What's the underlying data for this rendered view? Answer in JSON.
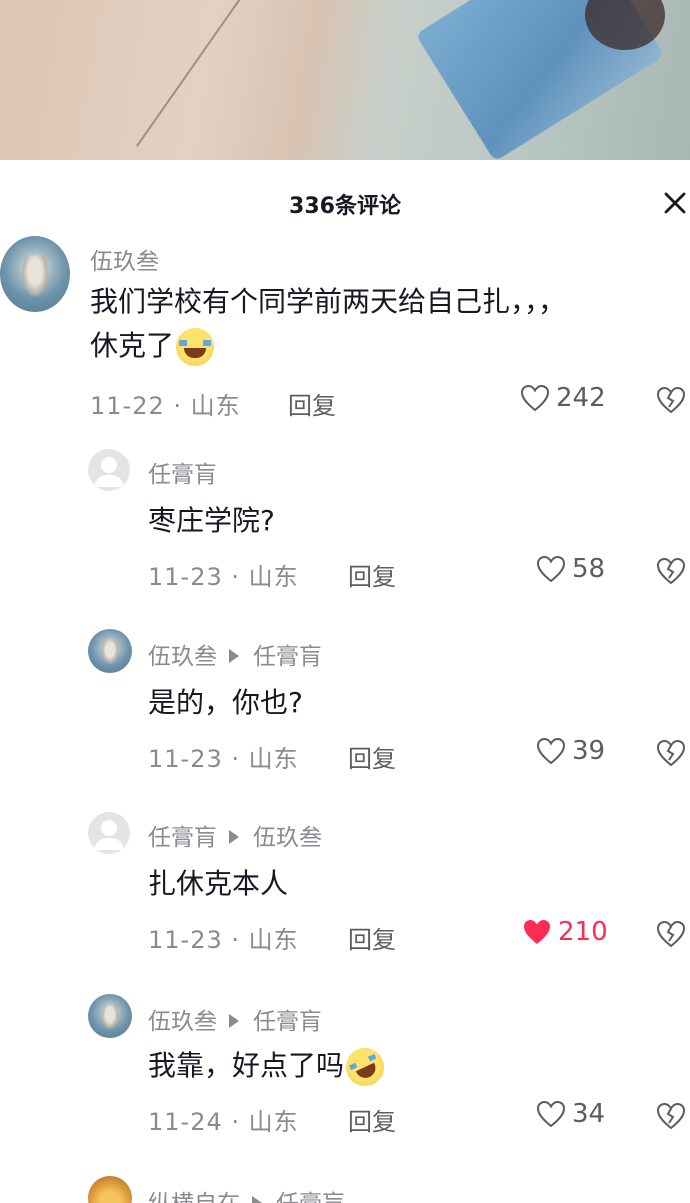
{
  "sheet": {
    "title": "336条评论",
    "close_label": "×"
  },
  "comments": [
    {
      "user": "伍玖叁",
      "text": "我们学校有个同学前两天给自己扎，，，",
      "text_line2": "休克了",
      "emoji": "face-with-tears-of-joy",
      "date": "11-22",
      "location": "山东",
      "reply_label": "回复",
      "likes": "242",
      "liked": false
    }
  ],
  "replies": [
    {
      "user": "任膏肓",
      "reply_to": "",
      "text": "枣庄学院?",
      "date": "11-23",
      "location": "山东",
      "reply_label": "回复",
      "likes": "58",
      "liked": false
    },
    {
      "user": "伍玖叁",
      "reply_to": "任膏肓",
      "text": "是的，你也?",
      "date": "11-23",
      "location": "山东",
      "reply_label": "回复",
      "likes": "39",
      "liked": false
    },
    {
      "user": "任膏肓",
      "reply_to": "伍玖叁",
      "text": "扎休克本人",
      "date": "11-23",
      "location": "山东",
      "reply_label": "回复",
      "likes": "210",
      "liked": true
    },
    {
      "user": "伍玖叁",
      "reply_to": "任膏肓",
      "text": "我靠，好点了吗",
      "emoji": "rolling-on-the-floor-laughing",
      "date": "11-24",
      "location": "山东",
      "reply_label": "回复",
      "likes": "34",
      "liked": false
    },
    {
      "user": "纵横自在",
      "reply_to": "任膏肓"
    }
  ],
  "meta_separator": " · ",
  "colors": {
    "like_active": "#fe2c55",
    "muted_text": "#8a8b91",
    "primary_text": "#161823"
  }
}
